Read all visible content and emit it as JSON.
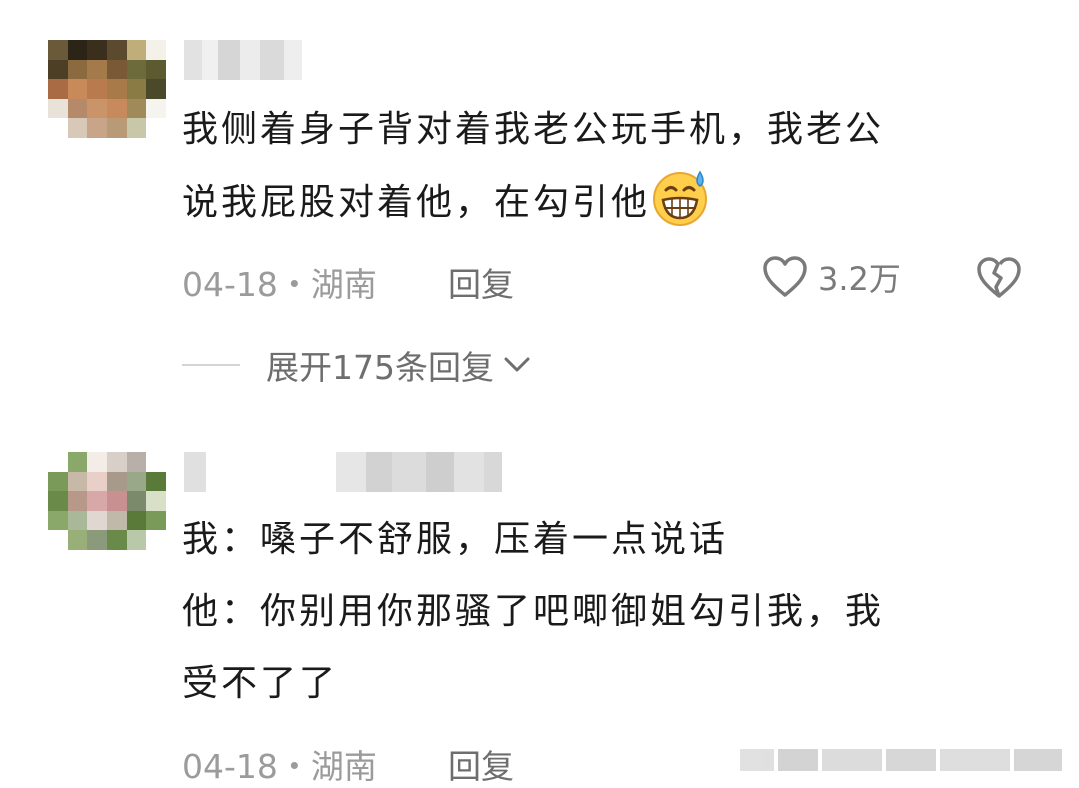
{
  "comments": [
    {
      "text_lines": [
        "我侧着身子背对着我老公玩手机，我老公",
        "说我屁股对着他，在勾引他"
      ],
      "emoji": "grinning-sweat-emoji",
      "date_location": "04-18・湖南",
      "reply_label": "回复",
      "likes": "3.2万",
      "expand_label": "展开175条回复"
    },
    {
      "text_lines": [
        "我：嗓子不舒服，压着一点说话",
        "他：你别用你那骚了吧唧御姐勾引我，我",
        "受不了了"
      ],
      "date_location": "04-18・湖南",
      "reply_label": "回复"
    }
  ],
  "colors": {
    "text": "#1a1a1a",
    "meta": "#9b9b9b",
    "icon": "#7a7a7a"
  }
}
